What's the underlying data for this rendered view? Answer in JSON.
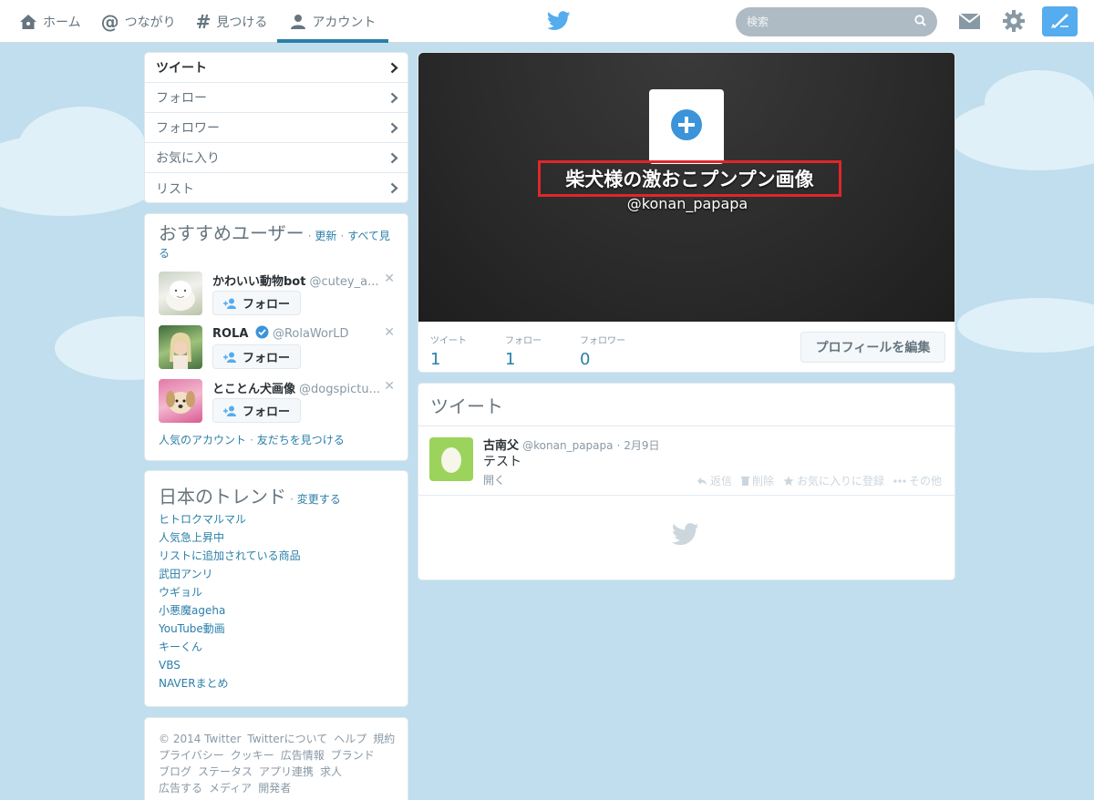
{
  "nav": {
    "home": "ホーム",
    "connect": "つながり",
    "discover": "見つける",
    "account": "アカウント"
  },
  "search": {
    "placeholder": "検索"
  },
  "profile_menu": [
    {
      "label": "ツイート"
    },
    {
      "label": "フォロー"
    },
    {
      "label": "フォロワー"
    },
    {
      "label": "お気に入り"
    },
    {
      "label": "リスト"
    }
  ],
  "who_to_follow": {
    "title": "おすすめユーザー",
    "refresh": "更新",
    "view_all": "すべて見る",
    "follow_label": "フォロー",
    "users": [
      {
        "name": "かわいい動物bot",
        "handle": "@cutey_a...",
        "verified": false
      },
      {
        "name": "ROLA",
        "handle": "@RolaWorLD",
        "verified": true
      },
      {
        "name": "とことん犬画像",
        "handle": "@dogspictu...",
        "verified": false
      }
    ],
    "popular_accounts": "人気のアカウント",
    "find_friends": "友だちを見つける"
  },
  "trends": {
    "title": "日本のトレンド",
    "change": "変更する",
    "items": [
      "ヒトロクマルマル",
      "人気急上昇中",
      "リストに追加されている商品",
      "武田アンリ",
      "ウギョル",
      "小悪魔ageha",
      "YouTube動画",
      "キーくん",
      "VBS",
      "NAVERまとめ"
    ]
  },
  "footer": {
    "line1": [
      "© 2014 Twitter",
      "Twitterについて",
      "ヘルプ",
      "規約"
    ],
    "line2": [
      "プライバシー",
      "クッキー",
      "広告情報",
      "ブランド"
    ],
    "line3": [
      "ブログ",
      "ステータス",
      "アプリ連携",
      "求人"
    ],
    "line4": [
      "広告する",
      "メディア",
      "開発者"
    ]
  },
  "profile": {
    "display_name": "柴犬様の激おこプンプン画像",
    "screen_name": "@konan_papapa",
    "stats": [
      {
        "label": "ツイート",
        "value": "1"
      },
      {
        "label": "フォロー",
        "value": "1"
      },
      {
        "label": "フォロワー",
        "value": "0"
      }
    ],
    "edit_button": "プロフィールを編集"
  },
  "timeline": {
    "title": "ツイート",
    "tweets": [
      {
        "name": "古南父",
        "handle": "@konan_papapa",
        "time": "2月9日",
        "text": "テスト",
        "expand": "開く",
        "actions": {
          "reply": "返信",
          "delete": "削除",
          "favorite": "お気に入りに登録",
          "more": "その他"
        }
      }
    ]
  },
  "colors": {
    "accent": "#55acee",
    "link": "#2a7fa8",
    "background": "#c0deed",
    "highlight_box": "#e0262b",
    "egg_avatar": "#9bd35c"
  }
}
